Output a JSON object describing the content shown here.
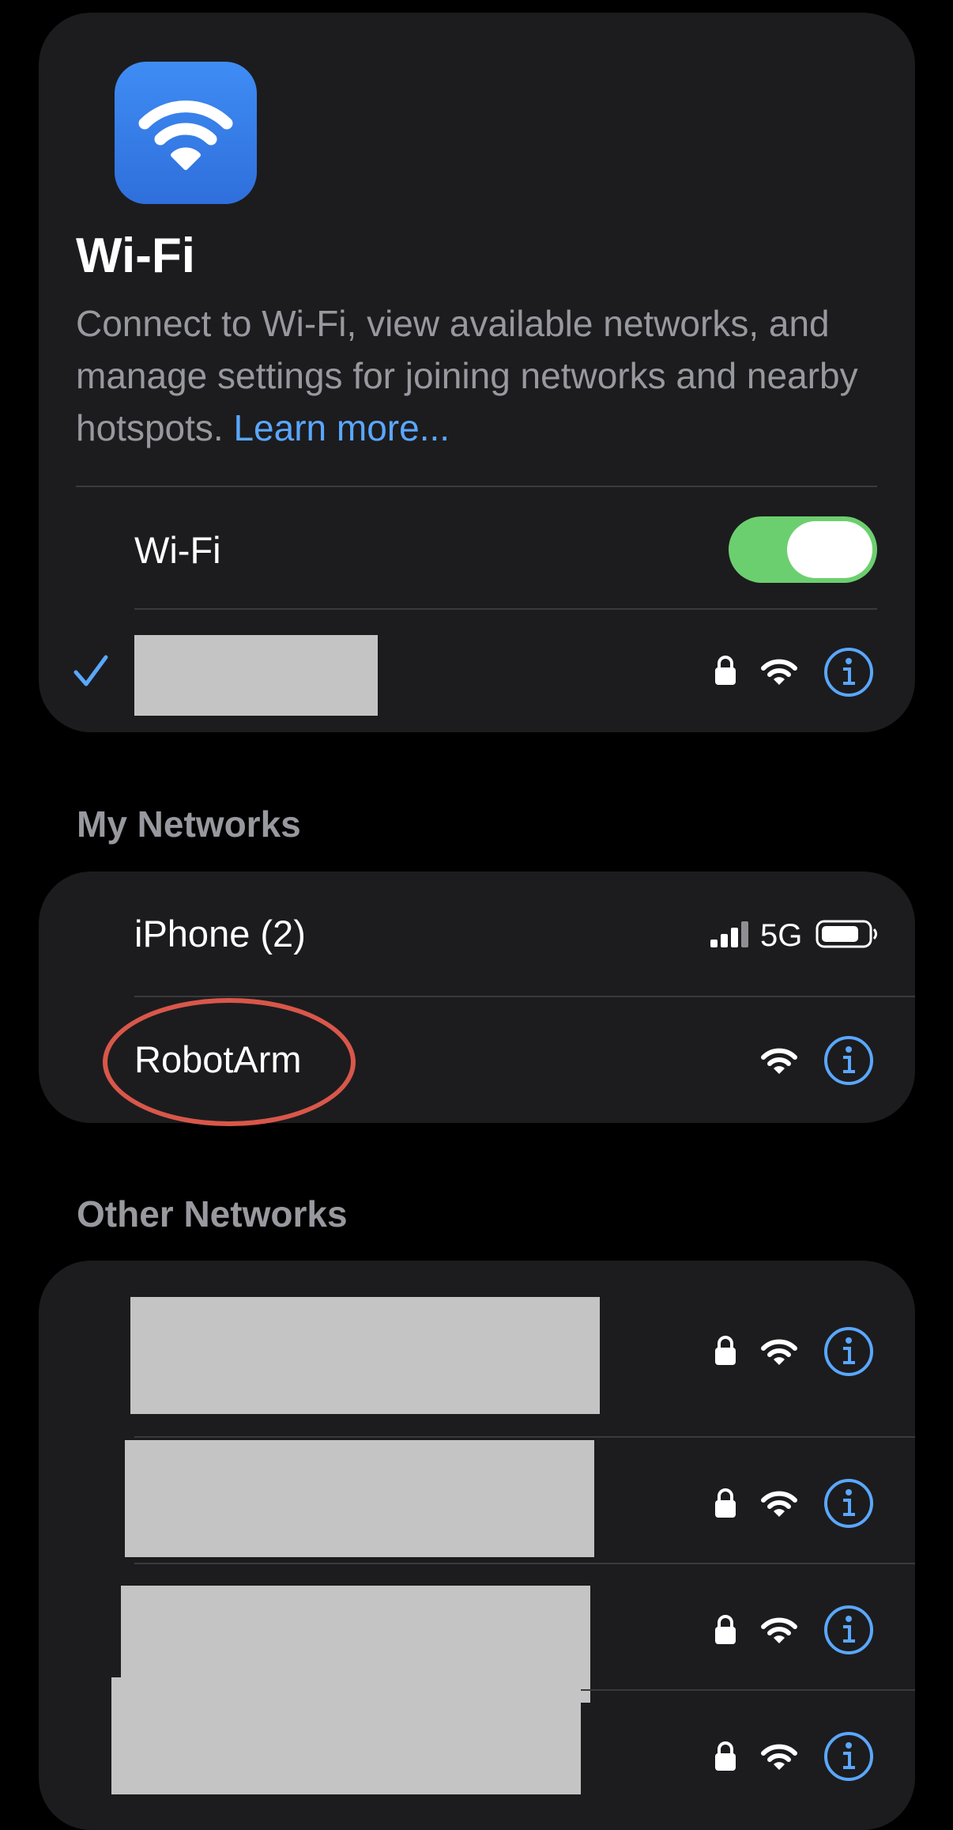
{
  "header": {
    "title": "Wi-Fi",
    "description": "Connect to Wi-Fi, view available networks, and manage settings for joining networks and nearby hotspots.",
    "learn_more_label": "Learn more..."
  },
  "wifi_toggle": {
    "label": "Wi-Fi",
    "state": "on"
  },
  "connected_network": {
    "name_redacted": true,
    "selected_icon": "checkmark-icon",
    "icons": [
      "lock-icon",
      "wifi-signal-icon",
      "info-icon"
    ]
  },
  "my_networks": {
    "header": "My Networks",
    "items": [
      {
        "name": "iPhone (2)",
        "network_type": "5G",
        "icons": [
          "cellular-signal-icon",
          "battery-icon"
        ]
      },
      {
        "name": "RobotArm",
        "icons": [
          "wifi-signal-icon",
          "info-icon"
        ],
        "annotated": true
      }
    ]
  },
  "other_networks": {
    "header": "Other Networks",
    "items": [
      {
        "name_redacted": true,
        "icons": [
          "lock-icon",
          "wifi-signal-icon",
          "info-icon"
        ]
      },
      {
        "name_redacted": true,
        "icons": [
          "lock-icon",
          "wifi-signal-icon",
          "info-icon"
        ]
      },
      {
        "name_redacted": true,
        "icons": [
          "lock-icon",
          "wifi-signal-icon",
          "info-icon"
        ]
      },
      {
        "name_redacted": true,
        "icons": [
          "lock-icon",
          "wifi-signal-icon",
          "info-icon"
        ]
      }
    ]
  },
  "colors": {
    "background": "#000000",
    "card": "#1c1c1e",
    "accent_blue": "#5aa7ff",
    "toggle_on": "#6ccf6f",
    "secondary_text": "#98989f",
    "annotation_red": "#d9574a",
    "redaction_gray": "#c4c4c4"
  }
}
